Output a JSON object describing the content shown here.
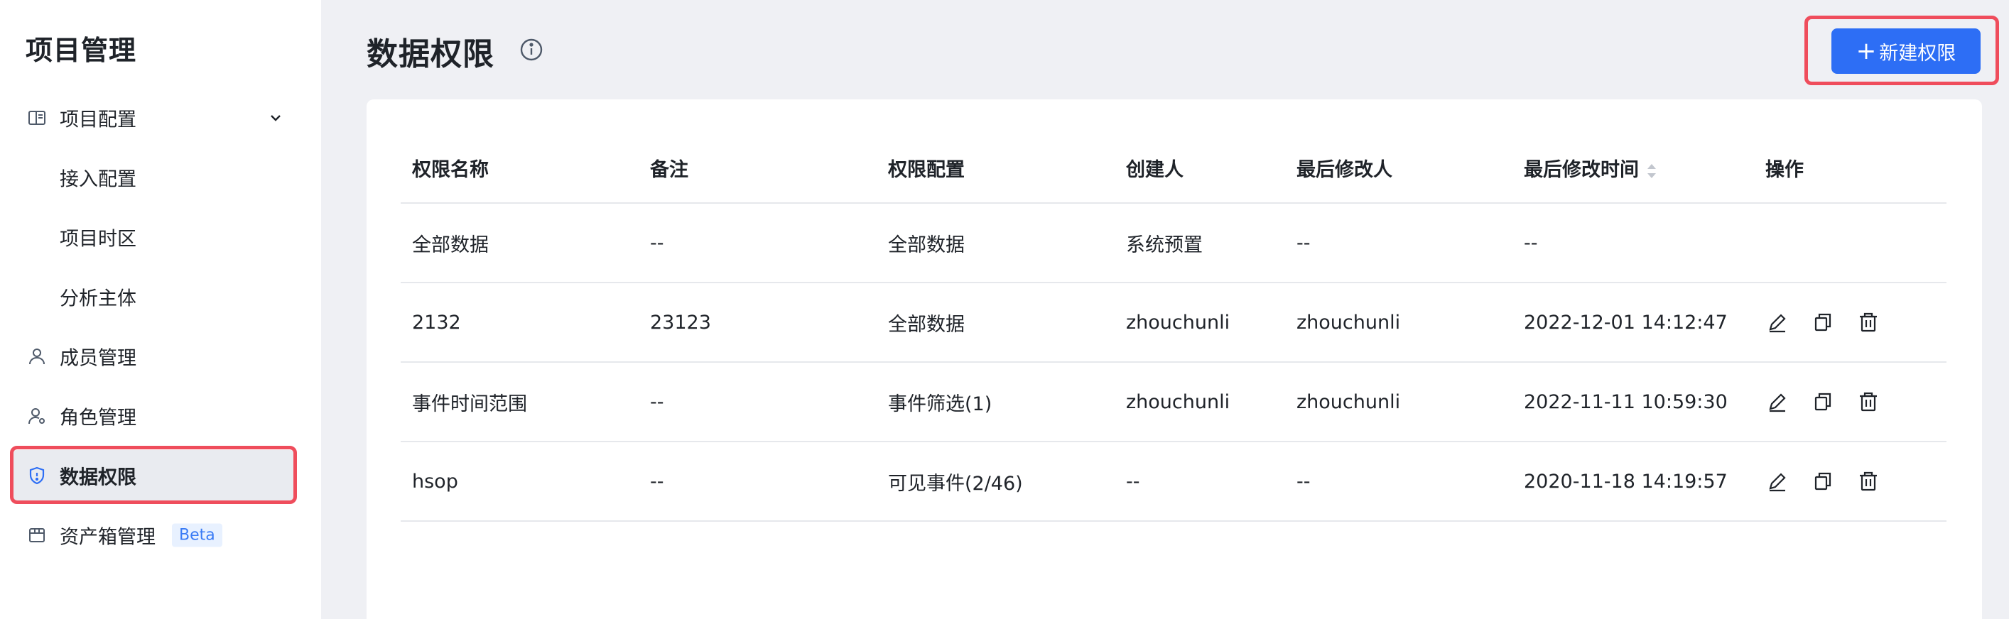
{
  "sidebar": {
    "title": "项目管理",
    "items": [
      {
        "label": "项目配置",
        "icon": "layout-icon"
      },
      {
        "label": "接入配置"
      },
      {
        "label": "项目时区"
      },
      {
        "label": "分析主体"
      },
      {
        "label": "成员管理",
        "icon": "user-icon"
      },
      {
        "label": "角色管理",
        "icon": "user-settings-icon"
      },
      {
        "label": "数据权限",
        "icon": "shield-icon"
      },
      {
        "label": "资产箱管理",
        "icon": "box-icon",
        "badge": "Beta"
      }
    ],
    "active_item": "数据权限"
  },
  "header": {
    "title": "数据权限",
    "new_button_plus": "+",
    "new_button_label": "新建权限"
  },
  "table": {
    "columns": [
      "权限名称",
      "备注",
      "权限配置",
      "创建人",
      "最后修改人",
      "最后修改时间",
      "操作"
    ],
    "rows": [
      {
        "name": "全部数据",
        "note": "--",
        "config": "全部数据",
        "creator": "系统预置",
        "modifier": "--",
        "time": "--",
        "ops": false
      },
      {
        "name": "2132",
        "note": "23123",
        "config": "全部数据",
        "creator": "zhouchunli",
        "modifier": "zhouchunli",
        "time": "2022-12-01 14:12:47",
        "ops": true
      },
      {
        "name": "事件时间范围",
        "note": "--",
        "config": "事件筛选(1)",
        "creator": "zhouchunli",
        "modifier": "zhouchunli",
        "time": "2022-11-11 10:59:30",
        "ops": true
      },
      {
        "name": "hsop",
        "note": "--",
        "config": "可见事件(2/46)",
        "creator": "--",
        "modifier": "--",
        "time": "2020-11-18 14:19:57",
        "ops": true
      }
    ]
  },
  "colors": {
    "primary": "#2d6ef5",
    "highlight": "#ef4d5c",
    "beta_bg": "#e8f1ff",
    "beta_text": "#3a7bf5"
  }
}
